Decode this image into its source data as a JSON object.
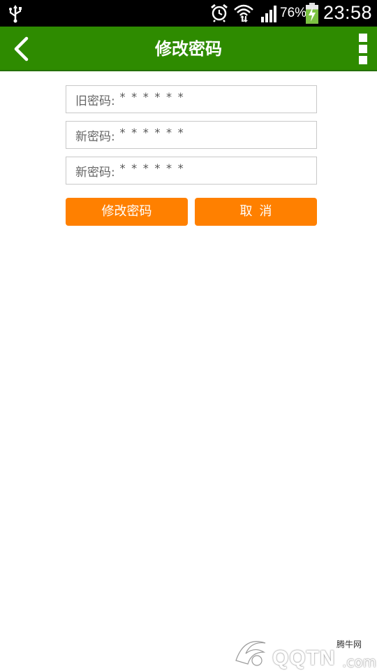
{
  "status_bar": {
    "battery_percent": "76%",
    "battery_level": 0.76,
    "time": "23:58",
    "icons": [
      "usb-icon",
      "alarm-icon",
      "wifi-icon",
      "signal-icon",
      "battery-charging-icon"
    ]
  },
  "header": {
    "title": "修改密码",
    "background_color": "#2e8b00",
    "icons": [
      "back-arrow-icon",
      "overflow-menu-icon"
    ]
  },
  "form": {
    "fields": [
      {
        "label": "旧密码:",
        "value": "******"
      },
      {
        "label": "新密码:",
        "value": "******"
      },
      {
        "label": "新密码:",
        "value": "******"
      }
    ]
  },
  "buttons": {
    "confirm_label": "修改密码",
    "cancel_label": "取消",
    "color": "#ff8000"
  },
  "watermark": {
    "site_name": "腾牛网",
    "brand": "QQTN",
    "suffix": ".com"
  }
}
